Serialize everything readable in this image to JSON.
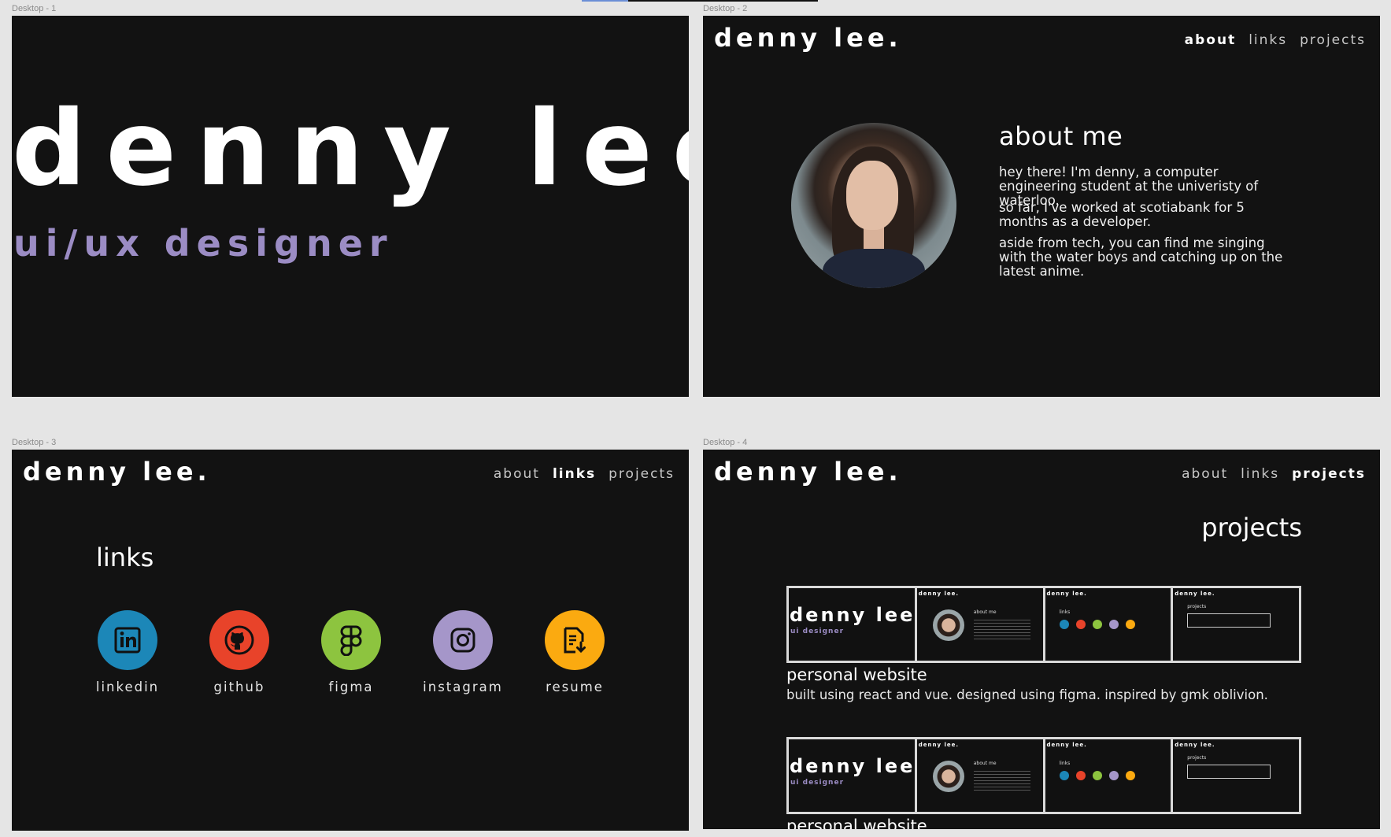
{
  "frames": [
    {
      "label": "Desktop - 1"
    },
    {
      "label": "Desktop - 2"
    },
    {
      "label": "Desktop - 3"
    },
    {
      "label": "Desktop - 4"
    }
  ],
  "brand": "denny lee.",
  "hero": {
    "name": "denny lee.",
    "role": "ui/ux designer"
  },
  "nav": {
    "about": "about",
    "links": "links",
    "projects": "projects"
  },
  "about": {
    "title": "about me",
    "paragraphs": [
      "hey there! I'm denny, a computer engineering student at the univeristy of waterloo.",
      "so far, I've worked at scotiabank for 5 months as a developer.",
      "aside from tech, you can find me singing with the water boys and catching up on the latest anime."
    ]
  },
  "links": {
    "title": "links",
    "items": [
      {
        "label": "linkedin",
        "color": "#1c87b8",
        "icon": "linkedin-icon"
      },
      {
        "label": "github",
        "color": "#e8432a",
        "icon": "github-icon"
      },
      {
        "label": "figma",
        "color": "#8dc43f",
        "icon": "figma-icon"
      },
      {
        "label": "instagram",
        "color": "#a596c9",
        "icon": "instagram-icon"
      },
      {
        "label": "resume",
        "color": "#fbaa10",
        "icon": "resume-icon"
      }
    ]
  },
  "projects": {
    "title": "projects",
    "items": [
      {
        "name": "personal website",
        "description": "built using react and vue. designed using figma. inspired by gmk oblivion."
      },
      {
        "name": "personal website",
        "description": ""
      }
    ],
    "thumb": {
      "brand": "denny lee.",
      "role": "ui designer",
      "about_head": "about me",
      "links_head": "links",
      "projects_head": "projects"
    }
  },
  "colors": {
    "background": "#121212",
    "accent": "#9b8cc4",
    "canvas": "#e5e5e5"
  }
}
